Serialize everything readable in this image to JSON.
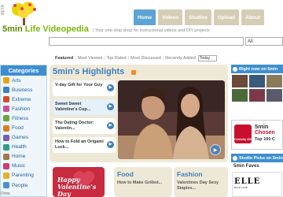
{
  "header": {
    "beta": "BETA",
    "logo_prefix": "5min",
    "logo_suffix": "Life Videopedia",
    "tagline": "| Your one-stop shop for instructional videos and DIY projects"
  },
  "nav": [
    "Home",
    "Videos",
    "Studios",
    "Upload",
    "About"
  ],
  "search": {
    "value": "",
    "scope": "All"
  },
  "filters": {
    "items": [
      "Featured",
      "Most Viewed",
      "Top Rated",
      "Most Discussed",
      "Recently Added"
    ],
    "period": "Today"
  },
  "categories": {
    "title": "Categories",
    "items": [
      {
        "label": "Arts",
        "color": "#e8a21a"
      },
      {
        "label": "Business",
        "color": "#3f7fbd"
      },
      {
        "label": "Extreme",
        "color": "#d44a2a"
      },
      {
        "label": "Fashion",
        "color": "#c7509a"
      },
      {
        "label": "Fitness",
        "color": "#6ba539"
      },
      {
        "label": "Food",
        "color": "#e07b20"
      },
      {
        "label": "Games",
        "color": "#7a5bb5"
      },
      {
        "label": "Health",
        "color": "#2e9c8a"
      },
      {
        "label": "Home",
        "color": "#a0784a"
      },
      {
        "label": "Music",
        "color": "#d23b6f"
      },
      {
        "label": "Parenting",
        "color": "#e0b020"
      },
      {
        "label": "People",
        "color": "#4c8fd0"
      }
    ]
  },
  "highlights": {
    "title": "5min's Highlights",
    "items": [
      {
        "text": "V-day Gift for Your Guy"
      },
      {
        "text": "Sweet Sweet Valentine's Cup..."
      },
      {
        "text": "The Dating Doctor: Valentin..."
      },
      {
        "text": "How to Fold an Origami Lock..."
      }
    ]
  },
  "cards": {
    "valentine": "Happy Valentine's Day",
    "food": {
      "title": "Food",
      "sub": "How to Make Grilled..."
    },
    "fashion": {
      "title": "Fashion",
      "sub": "Valentines Day Sexy Staples..."
    }
  },
  "right_col": {
    "header1": "Right now on 5min",
    "promo": {
      "badge": "Celebrity 400",
      "title": "5min",
      "chosen": "Chosen",
      "sub": "Top 100 C"
    },
    "header2": "Studio Picks on 5min",
    "faves_title": "5min Faves",
    "elle": "ELLE",
    "elle_sub": "ELLE LIVE"
  },
  "status": "Done",
  "colors": {
    "accent_blue": "#3e8ed0",
    "nav_inactive": "#d6cdb6",
    "nav_active": "#5da3d3",
    "panel_beige": "#eee9d7",
    "valentine_red": "#c82a3f"
  }
}
